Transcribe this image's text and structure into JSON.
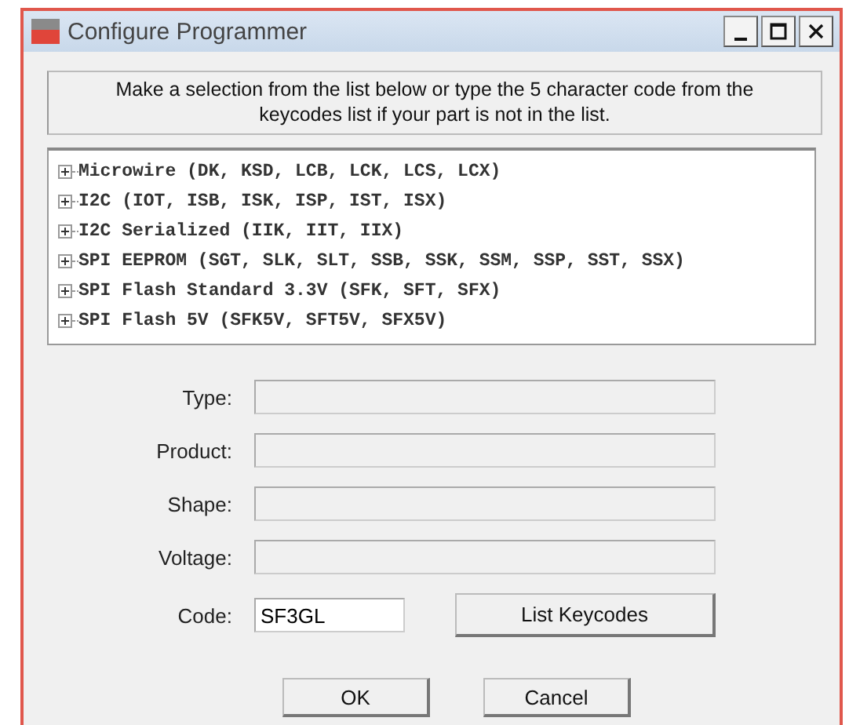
{
  "window": {
    "title": "Configure Programmer"
  },
  "instructions": "Make a selection from the list below or type the 5 character code from the keycodes list if your part is not in the list.",
  "tree": [
    {
      "label": "Microwire (DK, KSD, LCB, LCK, LCS, LCX)",
      "expanded": false
    },
    {
      "label": "I2C (IOT, ISB, ISK, ISP, IST, ISX)",
      "expanded": false
    },
    {
      "label": "I2C Serialized (IIK, IIT, IIX)",
      "expanded": false
    },
    {
      "label": "SPI EEPROM (SGT, SLK, SLT, SSB, SSK, SSM, SSP, SST, SSX)",
      "expanded": false
    },
    {
      "label": "SPI Flash Standard 3.3V (SFK, SFT, SFX)",
      "expanded": false
    },
    {
      "label": "SPI Flash 5V (SFK5V, SFT5V, SFX5V)",
      "expanded": false
    }
  ],
  "fields": [
    {
      "label": "Type:",
      "disabled": true
    },
    {
      "label": "Product:",
      "disabled": true
    },
    {
      "label": "Shape:",
      "disabled": true
    },
    {
      "label": "Voltage:",
      "disabled": true
    }
  ],
  "code": {
    "label": "Code:",
    "value": "SF3GL",
    "button": "List Keycodes"
  },
  "buttons": [
    "OK",
    "Cancel"
  ]
}
